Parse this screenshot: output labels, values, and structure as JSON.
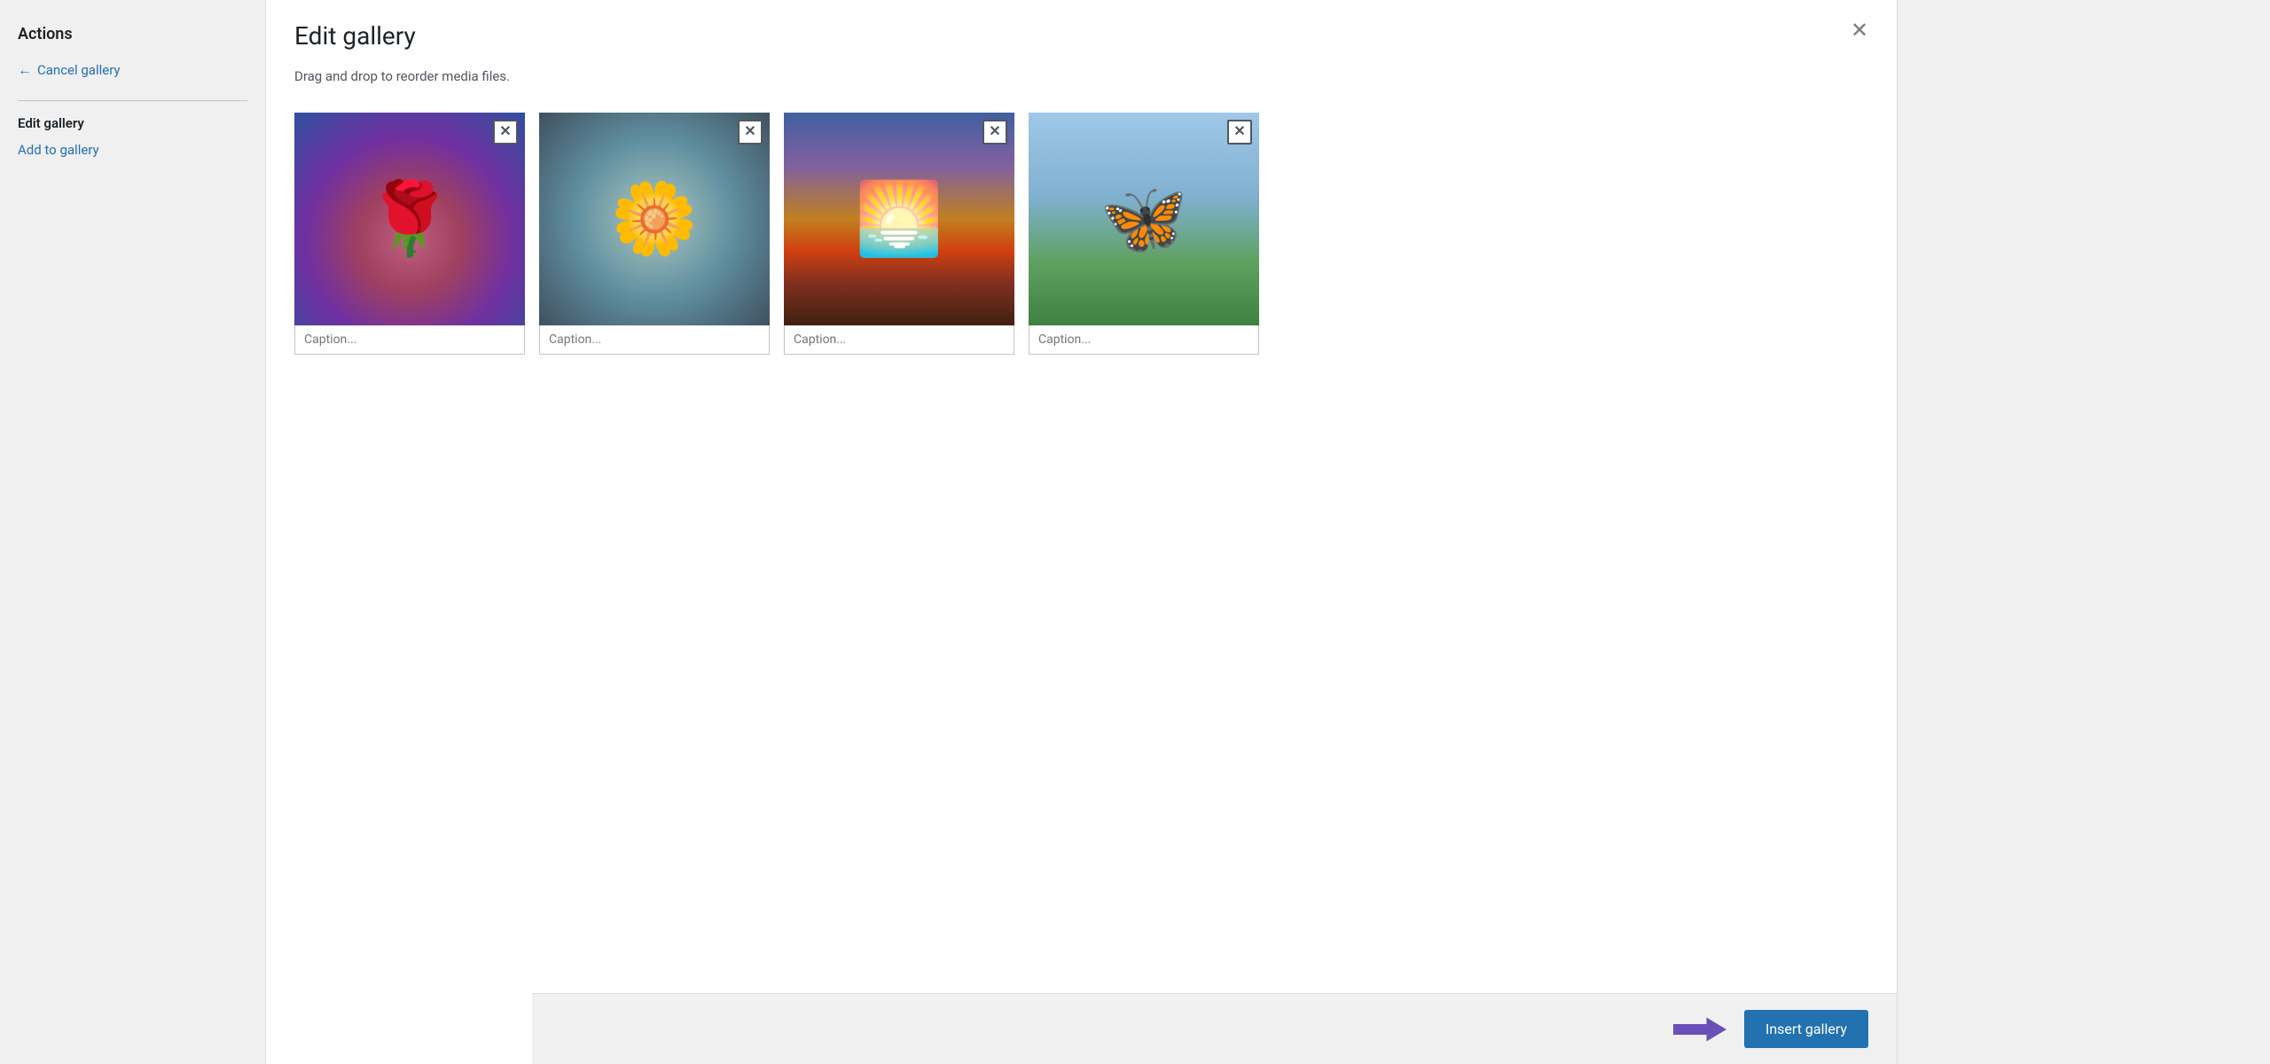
{
  "sidebar": {
    "actions_label": "Actions",
    "cancel_gallery_label": "Cancel gallery",
    "edit_gallery_label": "Edit gallery",
    "add_to_gallery_label": "Add to gallery"
  },
  "header": {
    "title": "Edit gallery",
    "close_button_label": "✕"
  },
  "main": {
    "drag_drop_hint": "Drag and drop to reorder media files.",
    "images": [
      {
        "id": "rose",
        "caption_placeholder": "Caption..."
      },
      {
        "id": "daisy",
        "caption_placeholder": "Caption..."
      },
      {
        "id": "sunset",
        "caption_placeholder": "Caption..."
      },
      {
        "id": "butterfly",
        "caption_placeholder": "Caption..."
      }
    ]
  },
  "footer": {
    "insert_gallery_label": "Insert gallery"
  },
  "icons": {
    "close": "✕",
    "remove": "✕",
    "back_arrow": "←",
    "right_arrow": "→"
  }
}
